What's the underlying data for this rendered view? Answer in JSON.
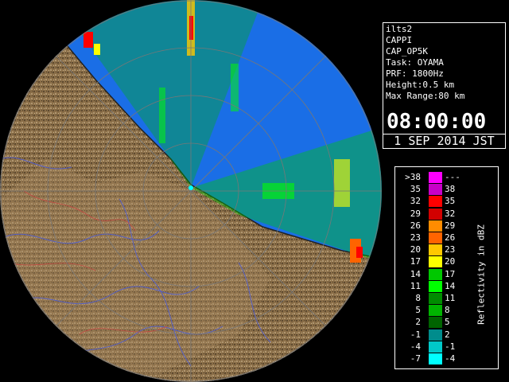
{
  "radar_info": {
    "site": "ilts2",
    "product": "CAPPI",
    "product_code": "CAP_OP5K",
    "task": "Task: OYAMA",
    "prf": "PRF: 1800Hz",
    "height": "Height:0.5 km",
    "max_range": "Max Range:80 km",
    "time": "08:00:00",
    "date": "1 SEP 2014 JST"
  },
  "legend": {
    "title": "Reflectivity in dBZ",
    "bins": [
      {
        "low": ">38",
        "high": "---",
        "color": "#ff00ff"
      },
      {
        "low": "35",
        "high": "38",
        "color": "#c800c8"
      },
      {
        "low": "32",
        "high": "35",
        "color": "#ff0000"
      },
      {
        "low": "29",
        "high": "32",
        "color": "#d20000"
      },
      {
        "low": "26",
        "high": "29",
        "color": "#ff8c00"
      },
      {
        "low": "23",
        "high": "26",
        "color": "#ff6400"
      },
      {
        "low": "20",
        "high": "23",
        "color": "#ffc800"
      },
      {
        "low": "17",
        "high": "20",
        "color": "#ffff00"
      },
      {
        "low": "14",
        "high": "17",
        "color": "#00c800"
      },
      {
        "low": "11",
        "high": "14",
        "color": "#00ff00"
      },
      {
        "low": "8",
        "high": "11",
        "color": "#008c00"
      },
      {
        "low": "5",
        "high": "8",
        "color": "#00b400"
      },
      {
        "low": "2",
        "high": "5",
        "color": "#006400"
      },
      {
        "low": "-1",
        "high": "2",
        "color": "#008c8c"
      },
      {
        "low": "-4",
        "high": "-1",
        "color": "#00c8c8"
      },
      {
        "low": "-7",
        "high": "-4",
        "color": "#00ffff"
      }
    ]
  },
  "map": {
    "sea_color": "#1a6ee6",
    "land_color": "#8a6e48",
    "background_color": "#000000"
  }
}
